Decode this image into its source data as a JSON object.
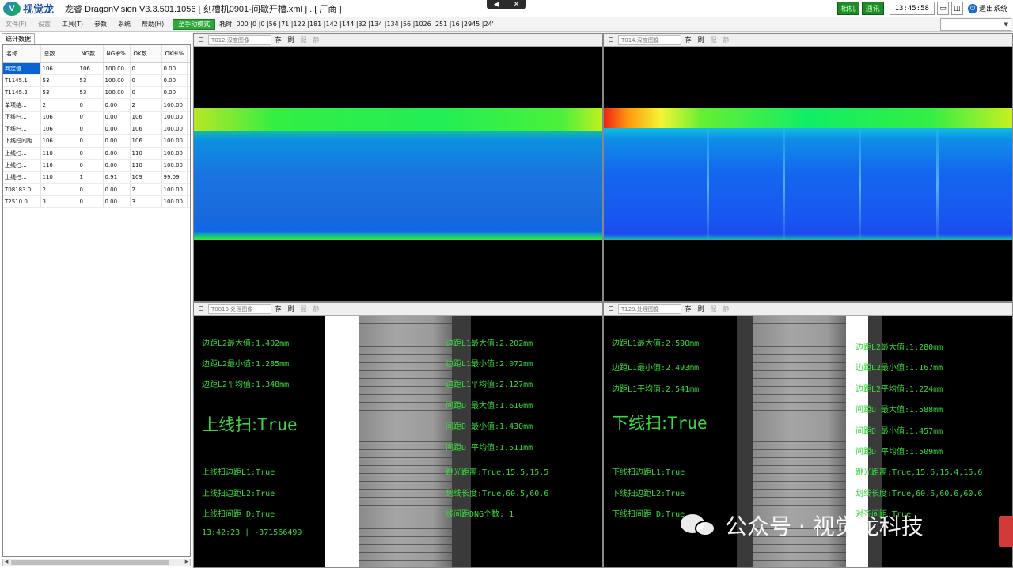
{
  "titlebar": {
    "logo_mark": "V",
    "logo_text": "视觉龙",
    "title": "龙睿 DragonVision V3.3.501.1056  [ 刻槽机0901-间歇开槽.xml ]  . [ 厂商 ]",
    "ctrl_mute": "◀",
    "ctrl_close": "✕",
    "camera_label": "相机",
    "comm_label": "通讯",
    "clock": "13:45:58",
    "min_label": "▭",
    "max_label": "◫",
    "exit_label": "退出系统"
  },
  "menu": {
    "items": [
      "文件(F)",
      "设置",
      "工具(T)",
      "参数",
      "系统",
      "帮助(H)"
    ],
    "mode_button": "至手动模式",
    "timing": "耗时: 000 |0 |0 |56 |71 |122 |181 |142 |144 |32 |134 |134 |56 |1026 |251 |16 |2945 |24'"
  },
  "stats": {
    "tab_label": "统计数据",
    "columns": [
      "名称",
      "总数",
      "NG数",
      "NG率%",
      "OK数",
      "OK率%"
    ],
    "rows": [
      [
        "判定值",
        "106",
        "106",
        "100.00",
        "0",
        "0.00"
      ],
      [
        "T1145.1",
        "53",
        "53",
        "100.00",
        "0",
        "0.00"
      ],
      [
        "T1145.2",
        "53",
        "53",
        "100.00",
        "0",
        "0.00"
      ],
      [
        "单项结...",
        "2",
        "0",
        "0.00",
        "2",
        "100.00"
      ],
      [
        "下线扫...",
        "106",
        "0",
        "0.00",
        "106",
        "100.00"
      ],
      [
        "下线扫...",
        "106",
        "0",
        "0.00",
        "106",
        "100.00"
      ],
      [
        "下线扫间距",
        "106",
        "0",
        "0.00",
        "106",
        "100.00"
      ],
      [
        "上线扫...",
        "110",
        "0",
        "0.00",
        "110",
        "100.00"
      ],
      [
        "上线扫...",
        "110",
        "0",
        "0.00",
        "110",
        "100.00"
      ],
      [
        "上线扫...",
        "110",
        "1",
        "0.91",
        "109",
        "99.09"
      ],
      [
        "T08183.0",
        "2",
        "0",
        "0.00",
        "2",
        "100.00"
      ],
      [
        "T2510.0",
        "3",
        "0",
        "0.00",
        "3",
        "100.00"
      ]
    ]
  },
  "views": {
    "tl": {
      "pin": "口",
      "name": "T012.深度图像",
      "btn_save": "存",
      "btn_refresh": "刷",
      "btn_config": "配",
      "btn_static": "静"
    },
    "tr": {
      "pin": "口",
      "name": "T014.深度图像",
      "btn_save": "存",
      "btn_refresh": "刷",
      "btn_config": "配",
      "btn_static": "静"
    },
    "bl": {
      "pin": "口",
      "name": "T0813.处理图像",
      "btn_save": "存",
      "btn_refresh": "刷",
      "btn_config": "配",
      "btn_static": "静"
    },
    "br": {
      "pin": "口",
      "name": "T129.处理图像",
      "btn_save": "存",
      "btn_refresh": "刷",
      "btn_config": "配",
      "btn_static": "静"
    }
  },
  "overlay_bl": {
    "l2_max": "边距L2最大值:1.402mm",
    "l2_min": "边距L2最小值:1.285mm",
    "l2_avg": "边距L2平均值:1.348mm",
    "big_label": "上线扫:",
    "big_value": "True",
    "l1_result": "上线扫边距L1:True",
    "l2_result": "上线扫边距L2:True",
    "d_result": "上线扫间距 D:True",
    "timestamp": "13:42:23 | -371566499",
    "r_l1_max": "边距L1最大值:2.202mm",
    "r_l1_min": "边距L1最小值:2.072mm",
    "r_l1_avg": "边距L1平均值:2.127mm",
    "r_d_max": "间距D 最大值:1.610mm",
    "r_d_min": "间距D 最小值:1.430mm",
    "r_d_avg": "间距D 平均值:1.511mm",
    "r_jump": "跳光距离:True,15.5,15.5",
    "r_len": "划线长度:True,60.5,60.6",
    "r_ng": "线间距DNG个数: 1"
  },
  "overlay_br": {
    "l1_max": "边距L1最大值:2.590mm",
    "l1_min": "边距L1最小值:2.493mm",
    "l1_avg": "边距L1平均值:2.541mm",
    "big_label": "下线扫:",
    "big_value": "True",
    "l1_result": "下线扫边距L1:True",
    "l2_result": "下线扫边距L2:True",
    "d_result": "下线扫间距 D:True",
    "r_l2_max": "边距L2最大值:1.280mm",
    "r_l2_min": "边距L2最小值:1.167mm",
    "r_l2_avg": "边距L2平均值:1.224mm",
    "r_d_max": "间距D 最大值:1.588mm",
    "r_d_min": "间距D 最小值:1.457mm",
    "r_d_avg": "间距D 平均值:1.509mm",
    "r_jump": "跳光距离:True,15.6,15.4,15.6",
    "r_len": "划线长度:True,60.6,60.6,60.6",
    "r_align": "对齐间距:True"
  },
  "watermark": {
    "text": "公众号 · 视觉龙科技"
  },
  "colors": {
    "overlay_text": "#39d93d",
    "mode_button": "#2fa83a",
    "selected_row": "#0a64d0"
  }
}
